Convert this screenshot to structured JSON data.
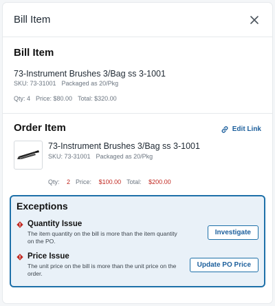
{
  "header": {
    "title": "Bill Item"
  },
  "bill_item": {
    "section_title": "Bill Item",
    "name": "73-Instrument Brushes 3/Bag ss 3-1001",
    "sku": "SKU: 73-31001",
    "packaging": "Packaged as 20/Pkg",
    "qty": "Qty: 4",
    "price": "Price: $80.00",
    "total": "Total: $320.00"
  },
  "order_item": {
    "section_title": "Order Item",
    "edit_link": "Edit Link",
    "name": "73-Instrument Brushes 3/Bag ss 3-1001",
    "sku": "SKU: 73-31001",
    "packaging": "Packaged as 20/Pkg",
    "qty_label": "Qty:",
    "qty_value": "2",
    "price_label": "Price:",
    "price_value": "$100.00",
    "total_label": "Total:",
    "total_value": "$200.00"
  },
  "exceptions": {
    "title": "Exceptions",
    "items": [
      {
        "title": "Quantity Issue",
        "description": "The item quantity on the bill is more than the item quantity on the PO.",
        "action": "Investigate"
      },
      {
        "title": "Price Issue",
        "description": "The unit price on the bill is more than the unit price on the order.",
        "action": "Update PO Price"
      }
    ]
  },
  "colors": {
    "accent": "#1c6fa8",
    "error": "#c0271f",
    "exceptions_bg": "#e9f1f8"
  },
  "icons": [
    "close-icon",
    "link-icon",
    "product-thumbnail",
    "warning-diamond-icon"
  ]
}
